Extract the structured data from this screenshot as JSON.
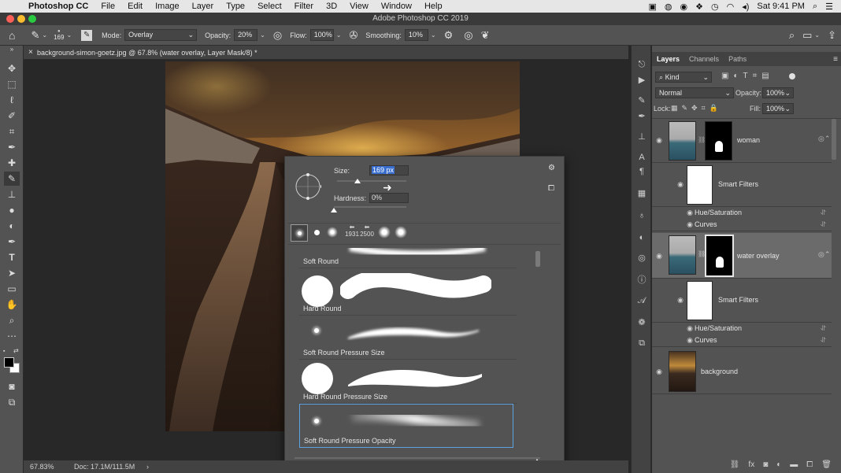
{
  "menubar": {
    "app": "Photoshop CC",
    "items": [
      "File",
      "Edit",
      "Image",
      "Layer",
      "Type",
      "Select",
      "Filter",
      "3D",
      "View",
      "Window",
      "Help"
    ],
    "clock": "Sat 9:41 PM"
  },
  "window": {
    "title": "Adobe Photoshop CC 2019"
  },
  "options": {
    "brush_size": "169",
    "mode_label": "Mode:",
    "mode_value": "Overlay",
    "opacity_label": "Opacity:",
    "opacity_value": "20%",
    "flow_label": "Flow:",
    "flow_value": "100%",
    "smoothing_label": "Smoothing:",
    "smoothing_value": "10%"
  },
  "document": {
    "tab_title": "background-simon-goetz.jpg @ 67.8% (water overlay, Layer Mask/8) *",
    "zoom": "67.83%",
    "doc_info": "Doc: 17.1M/111.5M"
  },
  "brush_popup": {
    "size_label": "Size:",
    "size_value": "169 px",
    "hardness_label": "Hardness:",
    "hardness_value": "0%",
    "size_level": 0.3,
    "hardness_level": 0.0,
    "presets": [
      {
        "type": "soft",
        "count": ""
      },
      {
        "type": "hard",
        "count": ""
      },
      {
        "type": "soft",
        "count": ""
      },
      {
        "type": "arrow",
        "count": "1931"
      },
      {
        "type": "arrow",
        "count": "2500"
      },
      {
        "type": "soft",
        "count": ""
      },
      {
        "type": "soft",
        "count": ""
      }
    ],
    "brushes": [
      {
        "name": "Soft Round",
        "kind": "soft-partial"
      },
      {
        "name": "Hard Round",
        "kind": "hard"
      },
      {
        "name": "Soft Round Pressure Size",
        "kind": "soft-taper"
      },
      {
        "name": "Hard Round Pressure Size",
        "kind": "hard-taper"
      },
      {
        "name": "Soft Round Pressure Opacity",
        "kind": "soft-opacity"
      }
    ]
  },
  "layers_panel": {
    "tabs": [
      "Layers",
      "Channels",
      "Paths"
    ],
    "filter_kind": "Kind",
    "blend_mode": "Normal",
    "opacity_label": "Opacity:",
    "opacity_value": "100%",
    "lock_label": "Lock:",
    "fill_label": "Fill:",
    "fill_value": "100%",
    "layers": [
      {
        "name": "woman",
        "type": "layer"
      },
      {
        "name": "Smart Filters",
        "type": "smart"
      },
      {
        "name": "Hue/Saturation",
        "type": "filter"
      },
      {
        "name": "Curves",
        "type": "filter"
      },
      {
        "name": "water overlay",
        "type": "layer"
      },
      {
        "name": "Smart Filters",
        "type": "smart"
      },
      {
        "name": "Hue/Saturation",
        "type": "filter"
      },
      {
        "name": "Curves",
        "type": "filter"
      },
      {
        "name": "background",
        "type": "layer"
      }
    ]
  },
  "colors": {
    "accent": "#3a6fcf",
    "panel": "#535353",
    "panel_dark": "#424242",
    "canvas_bg": "#282828"
  }
}
